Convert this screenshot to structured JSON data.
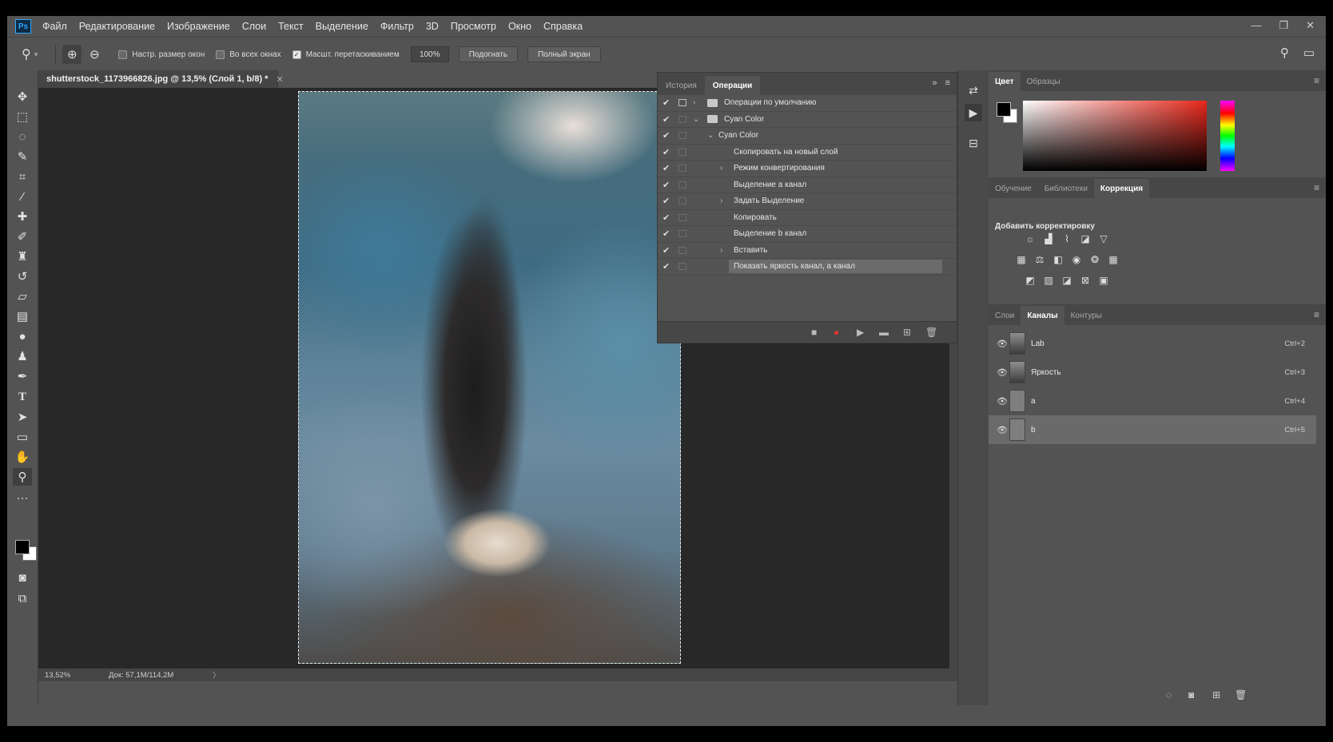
{
  "menubar": {
    "logo": "Ps",
    "items": [
      "Файл",
      "Редактирование",
      "Изображение",
      "Слои",
      "Текст",
      "Выделение",
      "Фильтр",
      "3D",
      "Просмотр",
      "Окно",
      "Справка"
    ],
    "win_min": "—",
    "win_restore": "❐",
    "win_close": "✕"
  },
  "options": {
    "resize_windows": "Настр. размер окон",
    "all_windows": "Во всех окнах",
    "scrubby_zoom": "Масшт. перетаскиванием",
    "zoom_value": "100%",
    "fit_btn": "Подогнать",
    "fullscreen_btn": "Полный экран"
  },
  "document": {
    "tab_title": "shutterstock_1173966826.jpg @ 13,5% (Слой 1, b/8) *",
    "tab_close": "✕",
    "status_zoom": "13,52%",
    "status_doc": "Док: 57,1M/114,2M",
    "status_arrow": "〉"
  },
  "actions_panel": {
    "tab_history": "История",
    "tab_actions": "Операции",
    "rows": [
      {
        "label": "Операции по умолчанию"
      },
      {
        "label": "Cyan Color"
      },
      {
        "label": "Cyan Color"
      },
      {
        "label": "Скопировать на новый слой"
      },
      {
        "label": "Режим конвертирования"
      },
      {
        "label": "Выделение a канал"
      },
      {
        "label": "Задать Выделение"
      },
      {
        "label": "Копировать"
      },
      {
        "label": "Выделение b канал"
      },
      {
        "label": "Вставить"
      },
      {
        "label": "Показать яркость канал, a канал"
      }
    ]
  },
  "color_panel": {
    "tab_color": "Цвет",
    "tab_swatches": "Образцы"
  },
  "adjustments_panel": {
    "tab_learn": "Обучение",
    "tab_libraries": "Библиотеки",
    "tab_adjustments": "Коррекция",
    "title": "Добавить корректировку"
  },
  "channels_panel": {
    "tab_layers": "Слои",
    "tab_channels": "Каналы",
    "tab_paths": "Контуры",
    "channels": [
      {
        "name": "Lab",
        "shortcut": "Ctrl+2"
      },
      {
        "name": "Яркость",
        "shortcut": "Ctrl+3"
      },
      {
        "name": "a",
        "shortcut": "Ctrl+4"
      },
      {
        "name": "b",
        "shortcut": "Ctrl+5"
      }
    ]
  }
}
